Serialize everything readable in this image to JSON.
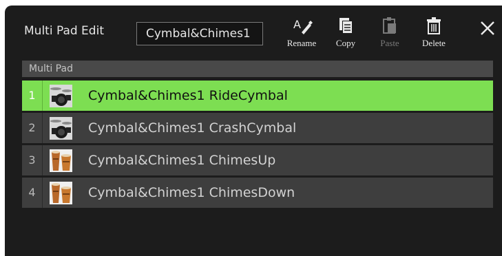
{
  "header": {
    "title": "Multi Pad Edit",
    "name_value": "Cymbal&Chimes1"
  },
  "toolbar": {
    "rename_label": "Rename",
    "copy_label": "Copy",
    "paste_label": "Paste",
    "delete_label": "Delete"
  },
  "list": {
    "header": "Multi Pad",
    "items": [
      {
        "number": "1",
        "name": "Cymbal&Chimes1 RideCymbal",
        "icon": "drum-kit-icon",
        "selected": true
      },
      {
        "number": "2",
        "name": "Cymbal&Chimes1 CrashCymbal",
        "icon": "drum-kit-icon",
        "selected": false
      },
      {
        "number": "3",
        "name": "Cymbal&Chimes1 ChimesUp",
        "icon": "bongo-drums-icon",
        "selected": false
      },
      {
        "number": "4",
        "name": "Cymbal&Chimes1 ChimesDown",
        "icon": "bongo-drums-icon",
        "selected": false
      }
    ]
  },
  "colors": {
    "selected_row": "#7dde52",
    "row": "#3e3e3e",
    "panel": "#1c1c1c"
  }
}
